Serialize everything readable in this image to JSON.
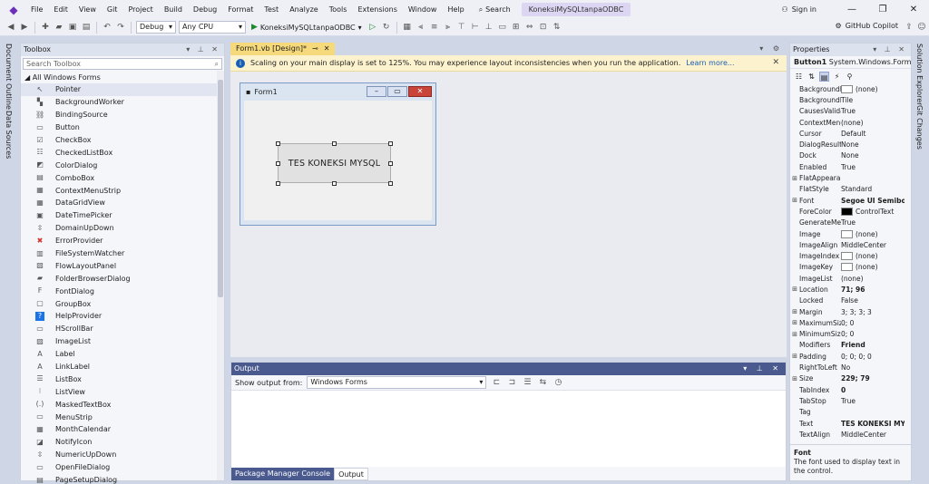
{
  "menubar": {
    "items": [
      "File",
      "Edit",
      "View",
      "Git",
      "Project",
      "Build",
      "Debug",
      "Format",
      "Test",
      "Analyze",
      "Tools",
      "Extensions",
      "Window",
      "Help"
    ],
    "search": "Search",
    "solution": "KoneksiMySQLtanpaODBC",
    "signin": "Sign in"
  },
  "toolbar": {
    "config": "Debug",
    "platform": "Any CPU",
    "startup": "KoneksiMySQLtanpaODBC",
    "copilot": "GitHub Copilot"
  },
  "leftstrip": {
    "tab1": "Document Outline",
    "tab2": "Data Sources"
  },
  "rightstrip": {
    "tab1": "Solution Explorer",
    "tab2": "Git Changes"
  },
  "toolbox": {
    "title": "Toolbox",
    "search_placeholder": "Search Toolbox",
    "group": "All Windows Forms",
    "items": [
      {
        "icon": "pointer-icon",
        "glyph": "↖",
        "label": "Pointer"
      },
      {
        "icon": "backgroundworker-icon",
        "glyph": "▚",
        "label": "BackgroundWorker"
      },
      {
        "icon": "bindingsource-icon",
        "glyph": "⛓",
        "label": "BindingSource"
      },
      {
        "icon": "button-icon",
        "glyph": "▭",
        "label": "Button"
      },
      {
        "icon": "checkbox-icon",
        "glyph": "☑",
        "label": "CheckBox"
      },
      {
        "icon": "checkedlistbox-icon",
        "glyph": "☷",
        "label": "CheckedListBox"
      },
      {
        "icon": "colordialog-icon",
        "glyph": "◩",
        "label": "ColorDialog"
      },
      {
        "icon": "combobox-icon",
        "glyph": "▤",
        "label": "ComboBox"
      },
      {
        "icon": "contextmenustrip-icon",
        "glyph": "▦",
        "label": "ContextMenuStrip"
      },
      {
        "icon": "datagridview-icon",
        "glyph": "▦",
        "label": "DataGridView"
      },
      {
        "icon": "datetimepicker-icon",
        "glyph": "▣",
        "label": "DateTimePicker"
      },
      {
        "icon": "domainupdown-icon",
        "glyph": "⇳",
        "label": "DomainUpDown"
      },
      {
        "icon": "errorprovider-icon",
        "glyph": "✖",
        "label": "ErrorProvider"
      },
      {
        "icon": "filesystemwatcher-icon",
        "glyph": "▥",
        "label": "FileSystemWatcher"
      },
      {
        "icon": "flowlayoutpanel-icon",
        "glyph": "▧",
        "label": "FlowLayoutPanel"
      },
      {
        "icon": "folderbrowserdialog-icon",
        "glyph": "▰",
        "label": "FolderBrowserDialog"
      },
      {
        "icon": "fontdialog-icon",
        "glyph": "F",
        "label": "FontDialog"
      },
      {
        "icon": "groupbox-icon",
        "glyph": "▢",
        "label": "GroupBox"
      },
      {
        "icon": "helpprovider-icon",
        "glyph": "?",
        "label": "HelpProvider"
      },
      {
        "icon": "hscrollbar-icon",
        "glyph": "▭",
        "label": "HScrollBar"
      },
      {
        "icon": "imagelist-icon",
        "glyph": "▨",
        "label": "ImageList"
      },
      {
        "icon": "label-icon",
        "glyph": "A",
        "label": "Label"
      },
      {
        "icon": "linklabel-icon",
        "glyph": "A",
        "label": "LinkLabel"
      },
      {
        "icon": "listbox-icon",
        "glyph": "☰",
        "label": "ListBox"
      },
      {
        "icon": "listview-icon",
        "glyph": "⁝",
        "label": "ListView"
      },
      {
        "icon": "maskedtextbox-icon",
        "glyph": "(.)",
        "label": "MaskedTextBox"
      },
      {
        "icon": "menustrip-icon",
        "glyph": "▭",
        "label": "MenuStrip"
      },
      {
        "icon": "monthcalendar-icon",
        "glyph": "▦",
        "label": "MonthCalendar"
      },
      {
        "icon": "notifyicon-icon",
        "glyph": "◪",
        "label": "NotifyIcon"
      },
      {
        "icon": "numericupdown-icon",
        "glyph": "⇳",
        "label": "NumericUpDown"
      },
      {
        "icon": "openfiledialog-icon",
        "glyph": "▭",
        "label": "OpenFileDialog"
      },
      {
        "icon": "pagesetupdialog-icon",
        "glyph": "▤",
        "label": "PageSetupDialog"
      }
    ]
  },
  "designer": {
    "tab": "Form1.vb [Design]*",
    "info": "Scaling on your main display is set to 125%. You may experience layout inconsistencies when you run the application.",
    "learn_more": "Learn more...",
    "form_title": "Form1",
    "button_text": "TES KONEKSI MYSQL"
  },
  "output": {
    "title": "Output",
    "show_from": "Show output from:",
    "source": "Windows Forms",
    "tabs": [
      "Package Manager Console",
      "Output"
    ]
  },
  "properties": {
    "title": "Properties",
    "object": "Button1",
    "object_type": "System.Windows.Forms",
    "rows": [
      {
        "exp": "",
        "name": "BackgroundImage",
        "value": "(none)",
        "swatch": "white"
      },
      {
        "exp": "",
        "name": "BackgroundImageLayout",
        "value": "Tile"
      },
      {
        "exp": "",
        "name": "CausesValidation",
        "value": "True"
      },
      {
        "exp": "",
        "name": "ContextMenuStrip",
        "value": "(none)"
      },
      {
        "exp": "",
        "name": "Cursor",
        "value": "Default"
      },
      {
        "exp": "",
        "name": "DialogResult",
        "value": "None"
      },
      {
        "exp": "",
        "name": "Dock",
        "value": "None"
      },
      {
        "exp": "",
        "name": "Enabled",
        "value": "True"
      },
      {
        "exp": "⊞",
        "name": "FlatAppearance",
        "value": ""
      },
      {
        "exp": "",
        "name": "FlatStyle",
        "value": "Standard"
      },
      {
        "exp": "⊞",
        "name": "Font",
        "value": "Segoe UI Semibold",
        "bold": true
      },
      {
        "exp": "",
        "name": "ForeColor",
        "value": "ControlText",
        "swatch": "black"
      },
      {
        "exp": "",
        "name": "GenerateMember",
        "value": "True"
      },
      {
        "exp": "",
        "name": "Image",
        "value": "(none)",
        "swatch": "white"
      },
      {
        "exp": "",
        "name": "ImageAlign",
        "value": "MiddleCenter"
      },
      {
        "exp": "",
        "name": "ImageIndex",
        "value": "(none)",
        "swatch": "white"
      },
      {
        "exp": "",
        "name": "ImageKey",
        "value": "(none)",
        "swatch": "white"
      },
      {
        "exp": "",
        "name": "ImageList",
        "value": "(none)"
      },
      {
        "exp": "⊞",
        "name": "Location",
        "value": "71; 96",
        "bold": true
      },
      {
        "exp": "",
        "name": "Locked",
        "value": "False"
      },
      {
        "exp": "⊞",
        "name": "Margin",
        "value": "3; 3; 3; 3"
      },
      {
        "exp": "⊞",
        "name": "MaximumSize",
        "value": "0; 0"
      },
      {
        "exp": "⊞",
        "name": "MinimumSize",
        "value": "0; 0"
      },
      {
        "exp": "",
        "name": "Modifiers",
        "value": "Friend",
        "bold": true
      },
      {
        "exp": "⊞",
        "name": "Padding",
        "value": "0; 0; 0; 0"
      },
      {
        "exp": "",
        "name": "RightToLeft",
        "value": "No"
      },
      {
        "exp": "⊞",
        "name": "Size",
        "value": "229; 79",
        "bold": true
      },
      {
        "exp": "",
        "name": "TabIndex",
        "value": "0",
        "bold": true
      },
      {
        "exp": "",
        "name": "TabStop",
        "value": "True"
      },
      {
        "exp": "",
        "name": "Tag",
        "value": ""
      },
      {
        "exp": "",
        "name": "Text",
        "value": "TES KONEKSI MY",
        "bold": true
      },
      {
        "exp": "",
        "name": "TextAlign",
        "value": "MiddleCenter"
      }
    ],
    "desc_title": "Font",
    "desc_text": "The font used to display text in the control."
  }
}
